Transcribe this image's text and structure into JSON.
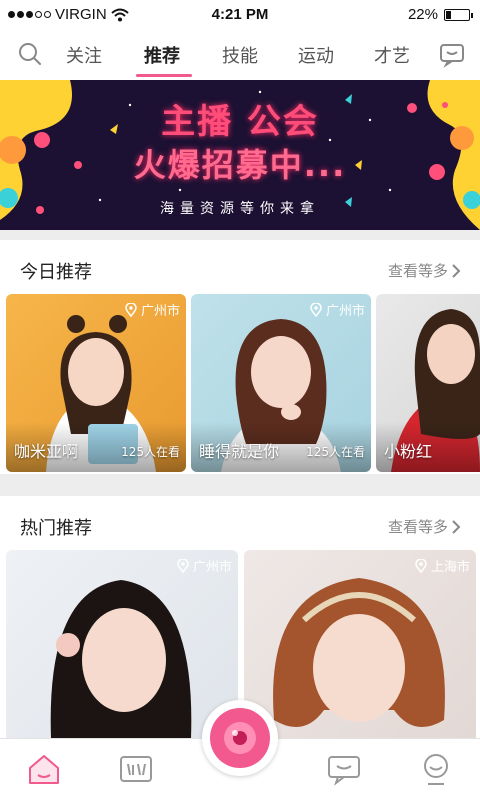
{
  "status_bar": {
    "carrier": "VIRGIN",
    "time": "4:21 PM",
    "battery": "22%",
    "battery_level": 0.22
  },
  "tabs": [
    {
      "label": "关注"
    },
    {
      "label": "推荐",
      "active": true
    },
    {
      "label": "技能"
    },
    {
      "label": "运动"
    },
    {
      "label": "才艺"
    }
  ],
  "banner": {
    "line1": "主播 公会",
    "line2": "火爆招募中...",
    "line3": "海量资源等你来拿"
  },
  "today": {
    "title": "今日推荐",
    "more": "查看等多",
    "cards": [
      {
        "location": "广州市",
        "name": "咖米亚啊",
        "viewers": "125人在看"
      },
      {
        "location": "广州市",
        "name": "睡得就是你",
        "viewers": "125人在看"
      },
      {
        "name": "小粉红"
      }
    ]
  },
  "hot": {
    "title": "热门推荐",
    "more": "查看等多",
    "cards": [
      {
        "location": "广州市"
      },
      {
        "location": "上海市"
      }
    ]
  },
  "colors": {
    "accent": "#f2598e",
    "banner_bg": "#1c1133",
    "neon": "#ff4d7a"
  },
  "icons": {
    "header_left": "search-icon",
    "header_right": "message-icon",
    "nav": [
      "home-icon",
      "video-icon",
      "record-icon",
      "chat-icon",
      "profile-icon"
    ]
  }
}
